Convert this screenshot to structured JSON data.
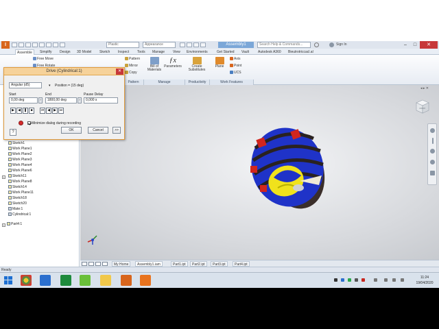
{
  "title_bar": {
    "logo": "I",
    "material_dropdown": "Plastic",
    "appearance_dropdown": "Appearance",
    "document_title": "Assembly1",
    "search_placeholder": "Search Help & Commands...",
    "user": "Sign In",
    "minimize": "–",
    "maximize": "□",
    "close": "✕"
  },
  "ribbon_tabs": [
    "Assemble",
    "Simplify",
    "Design",
    "3D Model",
    "Sketch",
    "Inspect",
    "Tools",
    "Manage",
    "View",
    "Environments",
    "Get Started",
    "Vault",
    "Autodesk A360",
    "Bieutrotriccacl.al"
  ],
  "ribbon": {
    "free_move": "Free Move",
    "free_rotate": "Free Rotate",
    "pattern": "Pattern",
    "mirror": "Mirror",
    "copy": "Copy",
    "bill_of_materials": "Bill of Materials",
    "parameters": "Parameters",
    "create_substitutes": "Create Substitutes",
    "plane": "Plane",
    "axis": "Axis",
    "point": "Point",
    "ucs": "UCS",
    "groups": [
      "Pattern",
      "Manage",
      "Productivity",
      "Work Features"
    ]
  },
  "drive_dialog": {
    "title": "Drive (Cylindrical:1)",
    "mode_dropdown": "Angular (d5)",
    "position": "Position = (15 deg)",
    "start_label": "Start",
    "start_value": "0,00 deg",
    "end_label": "End",
    "end_value": "1800,00 deg",
    "pause_label": "Pause Delay",
    "pause_value": "0,000 s",
    "minimize_label": "Minimize dialog during recording",
    "minimize_checked": true,
    "ok": "OK",
    "cancel": "Cancel",
    "more": ">>",
    "help": "?"
  },
  "browser_tree": [
    {
      "label": "Sketch1"
    },
    {
      "label": "Work Plane1"
    },
    {
      "label": "Work Plane2"
    },
    {
      "label": "Work Plane3"
    },
    {
      "label": "Work Plane4"
    },
    {
      "label": "Work Plane6"
    },
    {
      "label": "Sketch11"
    },
    {
      "label": "Work Plane8"
    },
    {
      "label": "Sketch14"
    },
    {
      "label": "Work Plane11"
    },
    {
      "label": "Sketch18"
    },
    {
      "label": "Sketch20"
    },
    {
      "label": "Mate:1"
    },
    {
      "label": "Cylindrical:1"
    },
    {
      "label": "Part4:1"
    }
  ],
  "viewport": {
    "close_document": "◂ ▸ ✕",
    "cube_face": "FRONT"
  },
  "document_tabs": [
    "My Home",
    "Assembly1.iam",
    "Part1.ipt",
    "Part2.ipt",
    "Part3.ipt",
    "Part4.ipt"
  ],
  "status_bar": {
    "text": "Ready"
  },
  "taskbar": {
    "time": "11:24",
    "date": "19/04/2020"
  }
}
